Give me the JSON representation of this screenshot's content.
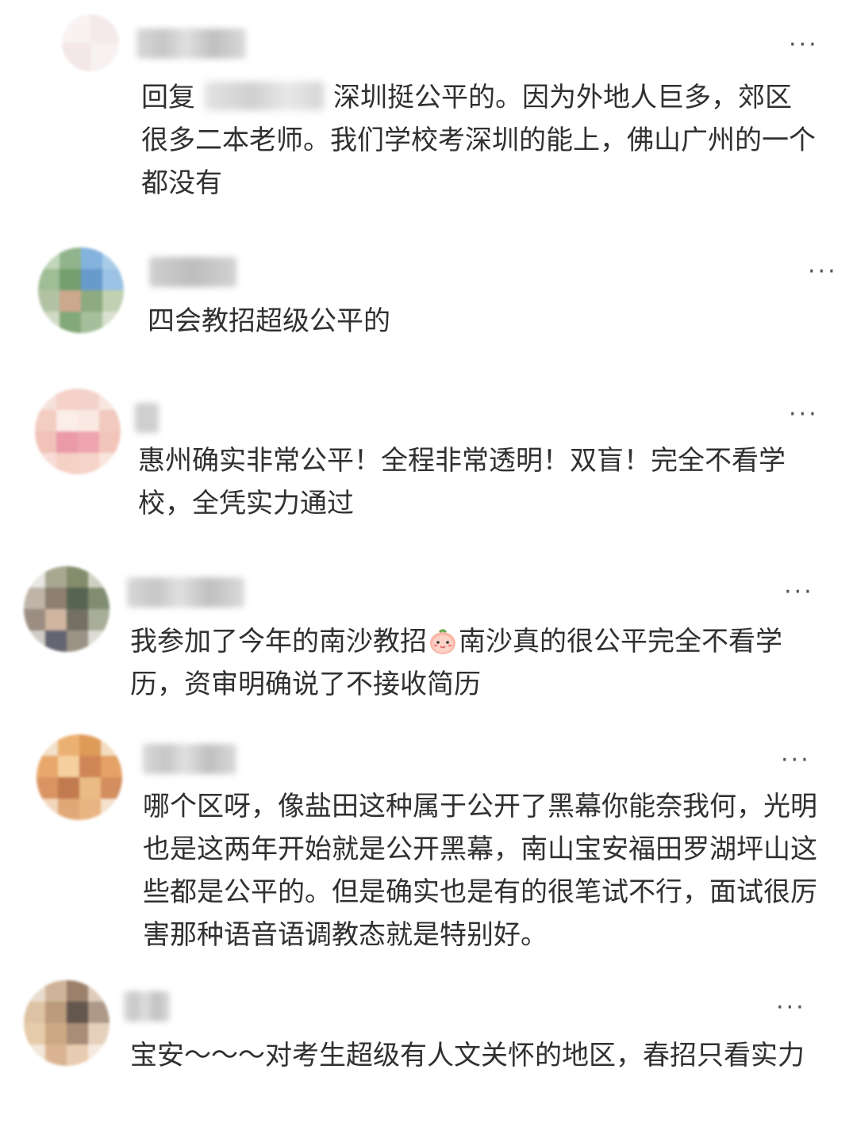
{
  "more_glyph": "···",
  "comments": [
    {
      "username": "",
      "text_reply_prefix": "回复",
      "text": "深圳挺公平的。因为外地人巨多，郊区很多二本老师。我们学校考深圳的能上，佛山广州的一个都没有"
    },
    {
      "username": "",
      "text": "四会教招超级公平的"
    },
    {
      "username": "",
      "text": "惠州确实非常公平！全程非常透明！双盲！完全不看学校，全凭实力通过"
    },
    {
      "username": "",
      "text_before_emoji": "我参加了今年的南沙教招",
      "emoji": "peach-face-emoji",
      "text_after_emoji": "南沙真的很公平完全不看学历，资审明确说了不接收简历"
    },
    {
      "username": "",
      "text": "哪个区呀，像盐田这种属于公开了黑幕你能奈我何，光明也是这两年开始就是公开黑幕，南山宝安福田罗湖坪山这些都是公平的。但是确实也是有的很笔试不行，面试很厉害那种语音语调教态就是特别好。"
    },
    {
      "username": "",
      "text": "宝安～～～对考生超级有人文关怀的地区，春招只看实力"
    }
  ],
  "colors": {
    "text": "#303030",
    "more": "#555555",
    "background": "#ffffff"
  }
}
